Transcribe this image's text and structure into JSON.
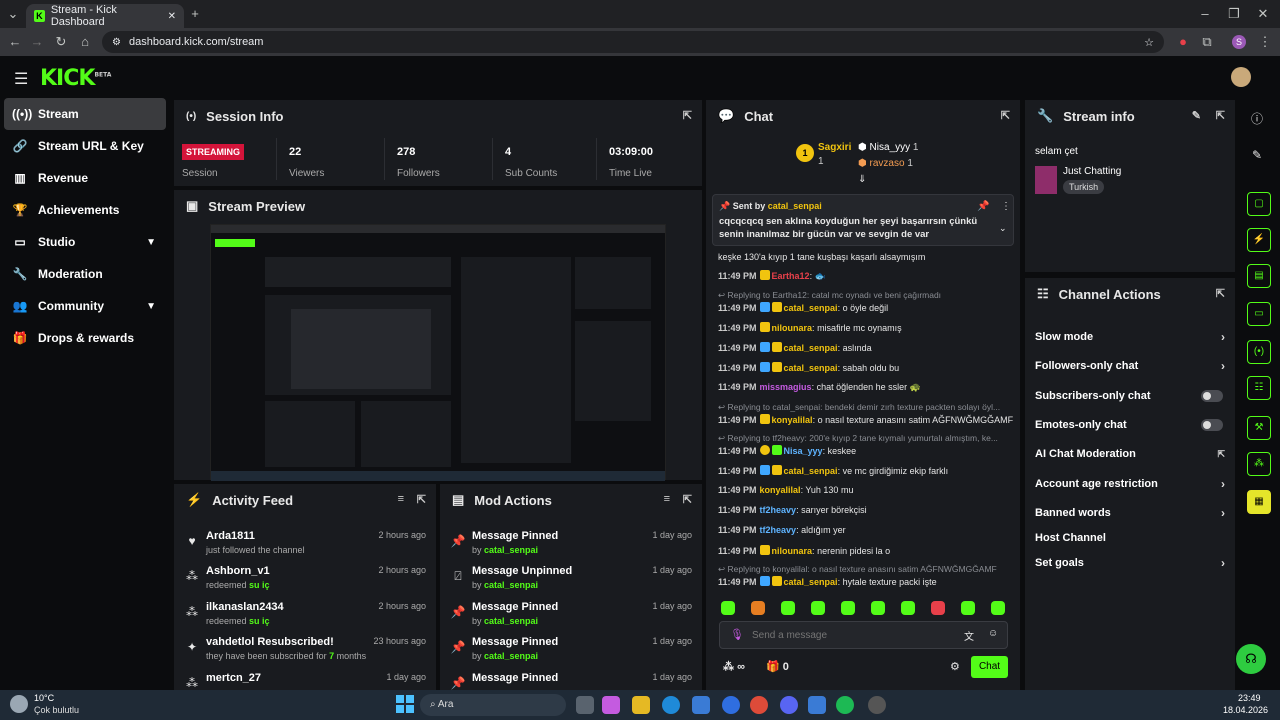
{
  "browser": {
    "tab_title": "Stream - Kick Dashboard",
    "url": "dashboard.kick.com/stream"
  },
  "app": {
    "logo": "KICK",
    "logo_tag": "BETA"
  },
  "sidebar": {
    "items": [
      {
        "label": "Stream",
        "icon": "broadcast-icon",
        "active": true
      },
      {
        "label": "Stream URL & Key",
        "icon": "link-icon"
      },
      {
        "label": "Revenue",
        "icon": "chart-icon"
      },
      {
        "label": "Achievements",
        "icon": "trophy-icon"
      },
      {
        "label": "Studio",
        "icon": "studio-icon",
        "expandable": true
      },
      {
        "label": "Moderation",
        "icon": "wrench-icon"
      },
      {
        "label": "Community",
        "icon": "people-icon",
        "expandable": true
      },
      {
        "label": "Drops & rewards",
        "icon": "gift-icon"
      }
    ]
  },
  "session_info": {
    "title": "Session Info",
    "status": "STREAMING",
    "status_label": "Session",
    "stats": [
      {
        "value": "22",
        "label": "Viewers"
      },
      {
        "value": "278",
        "label": "Followers"
      },
      {
        "value": "4",
        "label": "Sub Counts"
      },
      {
        "value": "03:09:00",
        "label": "Time Live"
      }
    ]
  },
  "stream_preview": {
    "title": "Stream Preview"
  },
  "activity_feed": {
    "title": "Activity Feed",
    "items": [
      {
        "icon": "heart-icon",
        "name": "Arda1811",
        "sub": "just followed the channel",
        "highlight": "",
        "time": "2 hours ago"
      },
      {
        "icon": "points-icon",
        "name": "Ashborn_v1",
        "sub": "redeemed",
        "highlight": "su iç",
        "time": "2 hours ago"
      },
      {
        "icon": "points-icon",
        "name": "ilkanaslan2434",
        "sub": "redeemed",
        "highlight": "su iç",
        "time": "2 hours ago"
      },
      {
        "icon": "sparkle-icon",
        "name": "vahdetlol Resubscribed!",
        "sub": "they have been subscribed for",
        "highlight": "7",
        "suffix": "months",
        "time": "23 hours ago"
      },
      {
        "icon": "points-icon",
        "name": "mertcn_27",
        "sub": "",
        "highlight": "",
        "time": "1 day ago"
      }
    ]
  },
  "mod_actions": {
    "title": "Mod Actions",
    "items": [
      {
        "icon": "pin-icon",
        "name": "Message Pinned",
        "by": "by",
        "user": "catal_senpai",
        "time": "1 day ago"
      },
      {
        "icon": "unpin-icon",
        "name": "Message Unpinned",
        "by": "by",
        "user": "catal_senpai",
        "time": "1 day ago"
      },
      {
        "icon": "pin-icon",
        "name": "Message Pinned",
        "by": "by",
        "user": "catal_senpai",
        "time": "1 day ago"
      },
      {
        "icon": "pin-icon",
        "name": "Message Pinned",
        "by": "by",
        "user": "catal_senpai",
        "time": "1 day ago"
      },
      {
        "icon": "pin-icon",
        "name": "Message Pinned",
        "by": "by",
        "user": "catal_senpai",
        "time": "1 day ago"
      }
    ]
  },
  "chat": {
    "title": "Chat",
    "top": {
      "first": "Sagxiri",
      "first_count": "1",
      "second": "Nisa_yyy",
      "second_count": "1",
      "third": "ravzaso",
      "third_count": "1"
    },
    "pinned": {
      "sent_by": "Sent by",
      "user": "catal_senpai",
      "text": "cqcqcqcq sen aklına koyduğun her şeyi başarırsın çünkü senin inanılmaz bir gücün var ve sevgin de var"
    },
    "messages": [
      {
        "time": "",
        "user": "",
        "text": "keşke 130'a kıyıp 1 tane kuşbaşı kaşarlı alsaymışım",
        "color": "#e6e6e6"
      },
      {
        "time": "11:49 PM",
        "user": "Eartha12",
        "text": "🐟",
        "color": "#e8404a"
      },
      {
        "reply": "Replying to Eartha12: catal mc oynadı ve beni çağırmadı"
      },
      {
        "time": "11:49 PM",
        "user": "catal_senpai",
        "text": "o öyle değil",
        "color": "#f1c40f"
      },
      {
        "time": "11:49 PM",
        "user": "nilounara",
        "text": "misafirle mc oynamış",
        "color": "#f1c40f"
      },
      {
        "time": "11:49 PM",
        "user": "catal_senpai",
        "text": "aslında",
        "color": "#f1c40f"
      },
      {
        "time": "11:49 PM",
        "user": "catal_senpai",
        "text": "sabah oldu bu",
        "color": "#f1c40f"
      },
      {
        "time": "11:49 PM",
        "user": "missmagius",
        "text": "chat öğlenden he ssler 🐢",
        "color": "#c45be0"
      },
      {
        "reply": "Replying to catal_senpai: bendeki demir zırh texture packten solayı öyl..."
      },
      {
        "time": "11:49 PM",
        "user": "konyalilal",
        "text": "o nasıl texture anasını satim AĞFNWĞMGĞAMF",
        "color": "#f1c40f"
      },
      {
        "reply": "Replying to tf2heavy: 200'e kıyıp 2 tane kıymalı yumurtalı almıştım, ke..."
      },
      {
        "time": "11:49 PM",
        "user": "Nisa_yyy",
        "text": "keskee",
        "color": "#5fb4ff"
      },
      {
        "time": "11:49 PM",
        "user": "catal_senpai",
        "text": "ve mc girdiğimiz ekip farklı",
        "color": "#f1c40f"
      },
      {
        "time": "11:49 PM",
        "user": "konyalilal",
        "text": "Yuh 130 mu",
        "color": "#f1c40f"
      },
      {
        "time": "11:49 PM",
        "user": "tf2heavy",
        "text": "sarıyer börekçisi",
        "color": "#5fb4ff"
      },
      {
        "time": "11:49 PM",
        "user": "tf2heavy",
        "text": "aldığım yer",
        "color": "#5fb4ff"
      },
      {
        "time": "11:49 PM",
        "user": "nilounara",
        "text": "nerenin pidesi la o",
        "color": "#f1c40f"
      },
      {
        "reply": "Replying to konyalilal: o nasıl texture anasını satim AĞFNWĞMGĞAMF"
      },
      {
        "time": "11:49 PM",
        "user": "catal_senpai",
        "text": "hytale texture packi işte",
        "color": "#f1c40f"
      }
    ],
    "input_placeholder": "Send a message",
    "points": "∞",
    "gifts": "0",
    "send_label": "Chat"
  },
  "stream_info": {
    "title": "Stream info",
    "stream_title": "selam çet",
    "category": "Just Chatting",
    "language": "Turkish"
  },
  "channel_actions": {
    "title": "Channel Actions",
    "items": [
      {
        "label": "Slow mode",
        "kind": "chevron"
      },
      {
        "label": "Followers-only chat",
        "kind": "chevron"
      },
      {
        "label": "Subscribers-only chat",
        "kind": "toggle"
      },
      {
        "label": "Emotes-only chat",
        "kind": "toggle"
      },
      {
        "label": "AI Chat Moderation",
        "kind": "external"
      },
      {
        "label": "Account age restriction",
        "kind": "chevron"
      },
      {
        "label": "Banned words",
        "kind": "chevron"
      },
      {
        "label": "Host Channel",
        "kind": "none"
      },
      {
        "label": "Set goals",
        "kind": "chevron"
      }
    ]
  },
  "taskbar": {
    "weather_temp": "10°C",
    "weather_desc": "Çok bulutlu",
    "search_label": "Ara",
    "time": "23:49",
    "date": "18.04.2026"
  },
  "colors": {
    "accent": "#53fc18",
    "live": "#d4143a",
    "panel": "#191b1f"
  }
}
